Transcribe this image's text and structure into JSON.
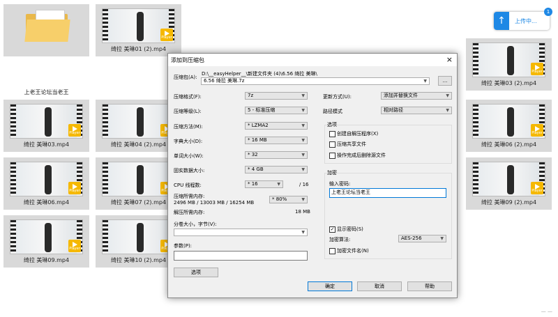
{
  "folder": {
    "caption": "上老王论坛当老王"
  },
  "videos": [
    {
      "caption": "绮拉 美琳01 (2).mp4"
    },
    {
      "caption": "绮拉 美琳03 (2).mp4"
    },
    {
      "caption": "绮拉 美琳03.mp4"
    },
    {
      "caption": "绮拉 美琳04 (2).mp4"
    },
    {
      "caption": "绮拉 美琳06 (2).mp4"
    },
    {
      "caption": "绮拉 美琳06.mp4"
    },
    {
      "caption": "绮拉 美琳07 (2).mp4"
    },
    {
      "caption": "绮拉 美琳09 (2).mp4"
    },
    {
      "caption": "绮拉 美琳09.mp4"
    },
    {
      "caption": "绮拉 美琳10 (2).mp4"
    }
  ],
  "upload": {
    "label": "上传中...",
    "badge": "1"
  },
  "player_label": "Player",
  "corner_text": "— —",
  "dialog": {
    "title": "添加到压缩包",
    "close": "×",
    "archive_label": "压缩包(A):",
    "archive_path": "D:\\__easyHelper__\\新建文件夹 (4)\\6.56 绮拉 美琳\\",
    "archive_name": "6.56 绮拉 美琳.7z",
    "browse": "...",
    "format_label": "压缩格式(F):",
    "format_value": "7z",
    "level_label": "压缩等级(L):",
    "level_value": "5 - 标准压缩",
    "method_label": "压缩方法(M):",
    "method_value": "* LZMA2",
    "dict_label": "字典大小(D):",
    "dict_value": "* 16 MB",
    "word_label": "单词大小(W):",
    "word_value": "* 32",
    "solid_label": "固实数据大小:",
    "solid_value": "* 4 GB",
    "cpu_label": "CPU 线程数:",
    "cpu_value": "* 16",
    "cpu_total": "/ 16",
    "mem_label": "压缩所需内存:",
    "mem_detail": "2496 MB / 13003 MB / 16254 MB",
    "mem_value": "* 80%",
    "unmem_label": "解压所需内存:",
    "unmem_value": "18 MB",
    "split_label": "分卷大小，字节(V):",
    "params_label": "参数(P):",
    "options_btn": "选项",
    "update_label": "更新方式(U):",
    "update_value": "添加并替换文件",
    "path_label": "路径模式",
    "path_value": "相对路径",
    "options_group": "选项",
    "opt_sfx": "创建自解压程序(X)",
    "opt_shared": "压缩共享文件",
    "opt_delete": "操作完成后删除源文件",
    "encrypt_group": "加密",
    "password_label": "输入密码:",
    "password_value": "上老王论坛当老王",
    "show_password": "显示密码(S)",
    "enc_method_label": "加密算法:",
    "enc_method_value": "AES-256",
    "encrypt_names": "加密文件名(N)",
    "ok": "确定",
    "cancel": "取消",
    "help": "帮助"
  }
}
